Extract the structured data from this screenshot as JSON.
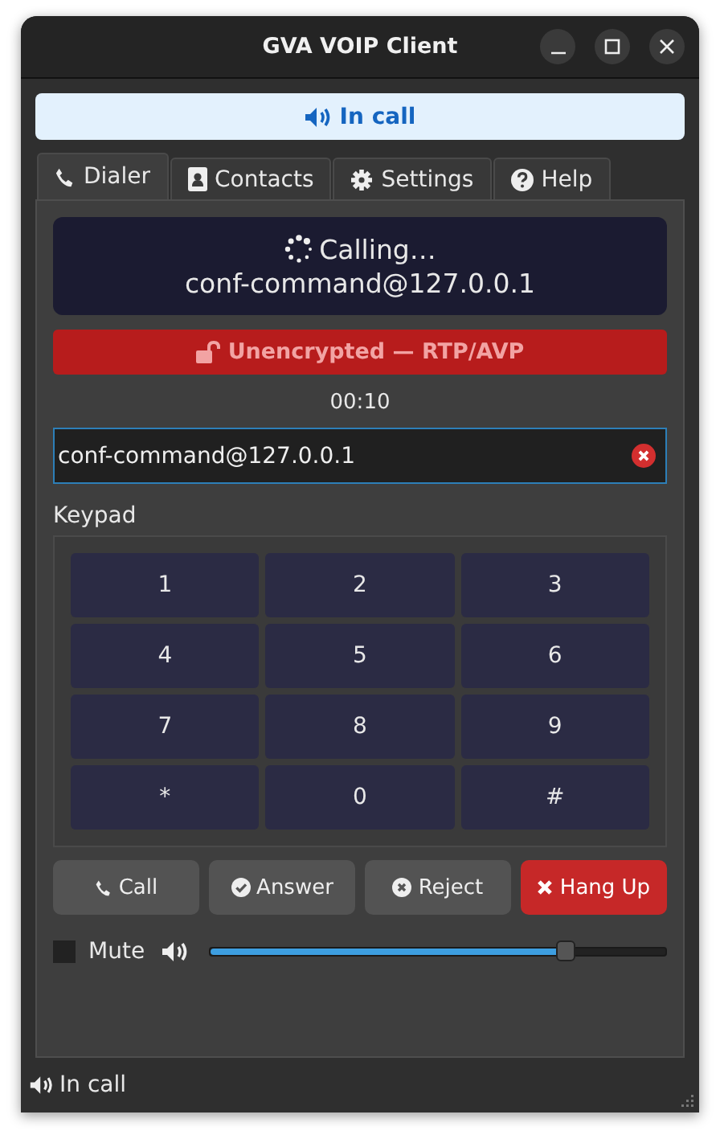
{
  "window": {
    "title": "GVA VOIP Client"
  },
  "banner": {
    "text": "In call"
  },
  "tabs": [
    {
      "label": "Dialer",
      "kind": "phone",
      "selected": true
    },
    {
      "label": "Contacts",
      "kind": "contact",
      "selected": false
    },
    {
      "label": "Settings",
      "kind": "gear",
      "selected": false
    },
    {
      "label": "Help",
      "kind": "help",
      "selected": false
    }
  ],
  "call_display": {
    "status": "Calling…",
    "target": "conf-command@127.0.0.1"
  },
  "security": {
    "text": "Unencrypted — RTP/AVP",
    "encrypted": false
  },
  "timer": "00:10",
  "address_field": {
    "value": "conf-command@127.0.0.1"
  },
  "keypad": {
    "label": "Keypad",
    "keys": [
      "1",
      "2",
      "3",
      "4",
      "5",
      "6",
      "7",
      "8",
      "9",
      "*",
      "0",
      "#"
    ]
  },
  "actions": [
    {
      "label": "Call",
      "kind": "call"
    },
    {
      "label": "Answer",
      "kind": "answer"
    },
    {
      "label": "Reject",
      "kind": "reject"
    },
    {
      "label": "Hang Up",
      "kind": "hangup"
    }
  ],
  "mute": {
    "label": "Mute",
    "checked": false
  },
  "volume": {
    "level": 0.78
  },
  "status_bar": {
    "text": "In call"
  }
}
